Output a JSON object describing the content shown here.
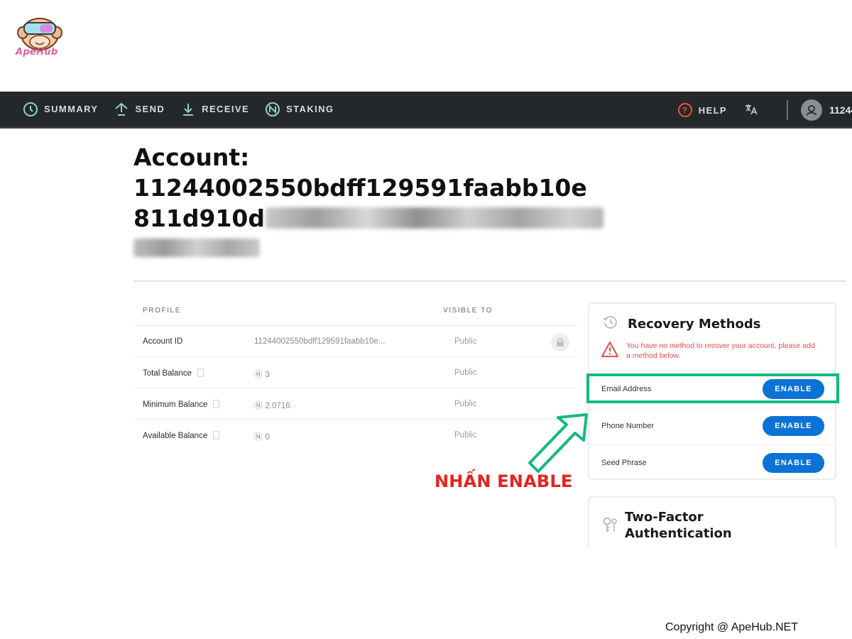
{
  "brand": {
    "logo_text": "ApeHub"
  },
  "nav": {
    "items": [
      {
        "label": "SUMMARY",
        "icon": "clock-icon"
      },
      {
        "label": "SEND",
        "icon": "send-icon"
      },
      {
        "label": "RECEIVE",
        "icon": "receive-icon"
      },
      {
        "label": "STAKING",
        "icon": "staking-icon"
      }
    ],
    "help_label": "HELP",
    "language_icon": "translate-icon",
    "account_short": "11244"
  },
  "account": {
    "heading_line1": "Account:",
    "heading_line2": "11244002550bdff129591faabb10e",
    "heading_line3": "811d910d"
  },
  "profile": {
    "header_profile": "PROFILE",
    "header_visible": "VISIBLE TO",
    "rows": [
      {
        "label": "Account ID",
        "value": "11244002550bdff129591faabb10e...",
        "visibility": "Public",
        "locked": true
      },
      {
        "label": "Total Balance",
        "value": "3",
        "visibility": "Public"
      },
      {
        "label": "Minimum Balance",
        "value": "2.0716",
        "visibility": "Public"
      },
      {
        "label": "Available Balance",
        "value": "0",
        "visibility": "Public"
      }
    ]
  },
  "recovery": {
    "title": "Recovery Methods",
    "warning": "You have no method to recover your account, please add a method below.",
    "methods": [
      {
        "label": "Email Address",
        "button": "ENABLE"
      },
      {
        "label": "Phone Number",
        "button": "ENABLE"
      },
      {
        "label": "Seed Phrase",
        "button": "ENABLE"
      }
    ]
  },
  "annotation": {
    "text": "NHẤN ENABLE"
  },
  "two_factor": {
    "title": "Two-Factor Authentication"
  },
  "footer": {
    "copyright": "Copyright @ ApeHub.NET"
  },
  "colors": {
    "navbar": "#25282a",
    "enable_button": "#0b72d6",
    "highlight": "#14b981",
    "warning": "#ea4b4b",
    "annotation": "#e4231f"
  }
}
